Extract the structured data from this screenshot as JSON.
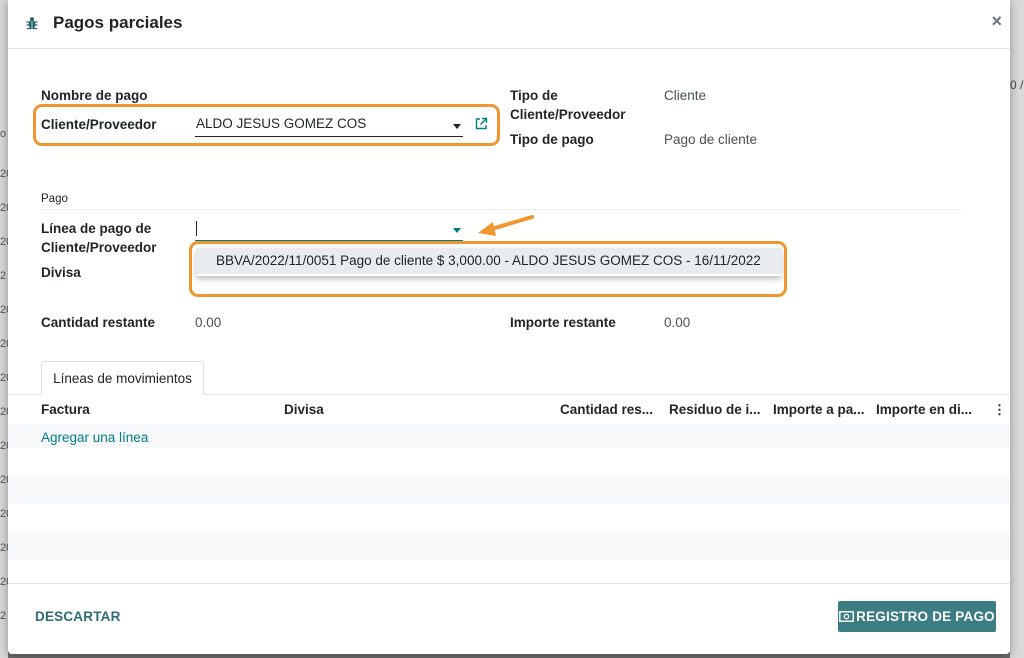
{
  "background": {
    "left_fragments": [
      "o",
      "20",
      "20",
      "20",
      "2",
      "20",
      "20",
      "20",
      "20",
      "20",
      "20",
      "20",
      "20",
      "20",
      "2"
    ],
    "right_fragment": "0 /"
  },
  "dialog": {
    "title": "Pagos parciales",
    "close_label": "×"
  },
  "form": {
    "nombre_de_pago_label": "Nombre de pago",
    "cliente_proveedor_label": "Cliente/Proveedor",
    "cliente_proveedor_value": "ALDO JESUS GOMEZ COS",
    "tipo_de_label_line1": "Tipo de",
    "tipo_de_label_line2": "Cliente/Proveedor",
    "tipo_de_value": "Cliente",
    "tipo_de_pago_label": "Tipo de pago",
    "tipo_de_pago_value": "Pago de cliente",
    "section_pago": "Pago",
    "linea_label_line1": "Línea de pago de",
    "linea_label_line2": "Cliente/Proveedor",
    "linea_value": "",
    "divisa_label": "Divisa",
    "cantidad_restante_label": "Cantidad restante",
    "cantidad_restante_value": "0.00",
    "importe_restante_label": "Importe restante",
    "importe_restante_value": "0.00"
  },
  "dropdown": {
    "options": [
      "BBVA/2022/11/0051 Pago de cliente $ 3,000.00 - ALDO JESUS GOMEZ COS - 16/11/2022"
    ]
  },
  "tabs": [
    {
      "label": "Líneas de movimientos"
    }
  ],
  "table": {
    "columns": [
      "Factura",
      "Divisa",
      "Cantidad res...",
      "Residuo de i...",
      "Importe a pa...",
      "Importe en di..."
    ],
    "add_line": "Agregar una línea",
    "options_icon": "⋮"
  },
  "footer": {
    "discard_label": "DESCARTAR",
    "register_label": "REGISTRO DE PAGO"
  },
  "colors": {
    "accent": "#017e84",
    "primary_button": "#3c7c83",
    "highlight": "#f0962e"
  }
}
